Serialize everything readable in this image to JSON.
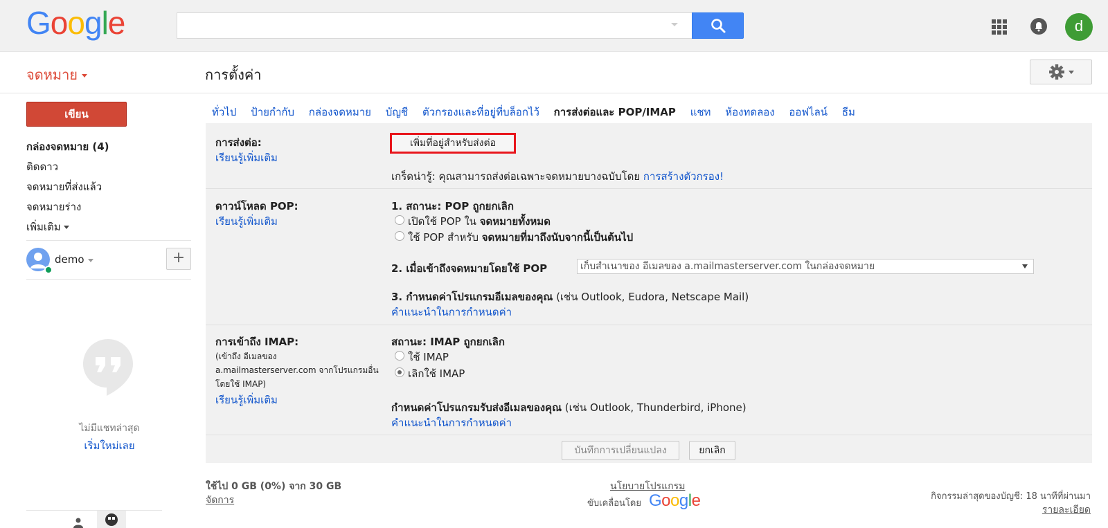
{
  "logo": {
    "letters": [
      "G",
      "o",
      "o",
      "g",
      "l",
      "e"
    ],
    "colors": [
      "#4285f4",
      "#ea4335",
      "#fbbc05",
      "#4285f4",
      "#34a853",
      "#ea4335"
    ]
  },
  "search": {
    "value": "",
    "placeholder": "",
    "button_icon": "search-icon"
  },
  "header": {
    "mail_label": "จดหมาย",
    "page_title": "การตั้งค่า",
    "avatar_letter": "d",
    "apps_icon": "apps-grid-icon",
    "notification_icon": "bell-icon",
    "settings_icon": "gear-icon"
  },
  "sidebar": {
    "compose_label": "เขียน",
    "items": [
      {
        "label": "กล่องจดหมาย (4)",
        "bold": true
      },
      {
        "label": "ติดดาว",
        "bold": false
      },
      {
        "label": "จดหมายที่ส่งแล้ว",
        "bold": false
      },
      {
        "label": "จดหมายร่าง",
        "bold": false
      },
      {
        "label": "เพิ่มเติม",
        "bold": false
      }
    ],
    "user_name": "demo",
    "add_chat": "+",
    "no_chats": "ไม่มีแชทล่าสุด",
    "start_new": "เริ่มใหม่เลย"
  },
  "tabs": [
    {
      "label": "ทั่วไป",
      "active": false
    },
    {
      "label": "ป้ายกำกับ",
      "active": false
    },
    {
      "label": "กล่องจดหมาย",
      "active": false
    },
    {
      "label": "บัญชี",
      "active": false
    },
    {
      "label": "ตัวกรองและที่อยู่ที่บล็อกไว้",
      "active": false
    },
    {
      "label": "การส่งต่อและ POP/IMAP",
      "active": true
    },
    {
      "label": "แชท",
      "active": false
    },
    {
      "label": "ห้องทดลอง",
      "active": false
    },
    {
      "label": "ออฟไลน์",
      "active": false
    },
    {
      "label": "ธีม",
      "active": false
    }
  ],
  "forwarding": {
    "label": "การส่งต่อ:",
    "learn_more": "เรียนรู้เพิ่มเติม",
    "add_button": "เพิ่มที่อยู่สำหรับส่งต่อ",
    "tip_prefix": "เกร็ดน่ารู้: คุณสามารถส่งต่อเฉพาะจดหมายบางฉบับโดย",
    "tip_link": "การสร้างตัวกรอง!"
  },
  "pop": {
    "label": "ดาวน์โหลด POP:",
    "learn_more": "เรียนรู้เพิ่มเติม",
    "status": "1. สถานะ: POP ถูกยกเลิก",
    "option1_prefix": "เปิดใช้ POP ใน",
    "option1_bold": "จดหมายทั้งหมด",
    "option2_prefix": "ใช้ POP สำหรับ",
    "option2_bold": "จดหมายที่มาถึงนับจากนี้เป็นต้นไป",
    "access_label": "2. เมื่อเข้าถึงจดหมายโดยใช้ POP",
    "access_select": "เก็บสำเนาของ อีเมลของ a.mailmasterserver.com ในกล่องจดหมาย",
    "config_bold": "3. กำหนดค่าโปรแกรมอีเมลของคุณ",
    "config_rest": "(เช่น Outlook, Eudora, Netscape Mail)",
    "config_link": "คำแนะนำในการกำหนดค่า"
  },
  "imap": {
    "label": "การเข้าถึง IMAP:",
    "desc_line1": "(เข้าถึง อีเมลของ",
    "desc_line2": "a.mailmasterserver.com จากโปรแกรมอื่น",
    "desc_line3": "โดยใช้ IMAP)",
    "learn_more": "เรียนรู้เพิ่มเติม",
    "status": "สถานะ: IMAP ถูกยกเลิก",
    "option_enable": "ใช้ IMAP",
    "option_disable": "เลิกใช้ IMAP",
    "selected": "disable",
    "config_bold": "กำหนดค่าโปรแกรมรับส่งอีเมลของคุณ",
    "config_rest": "(เช่น Outlook, Thunderbird, iPhone)",
    "config_link": "คำแนะนำในการกำหนดค่า"
  },
  "actions": {
    "save": "บันทึกการเปลี่ยนแปลง",
    "cancel": "ยกเลิก"
  },
  "footer": {
    "storage": "ใช้ไป 0 GB (0%) จาก 30 GB",
    "manage": "จัดการ",
    "privacy": "นโยบายโปรแกรม",
    "powered_by": "ขับเคลื่อนโดย",
    "powered_logo": "Google",
    "activity": "กิจกรรมล่าสุดของบัญชี: 18 นาทีที่ผ่านมา",
    "details": "รายละเอียด"
  }
}
